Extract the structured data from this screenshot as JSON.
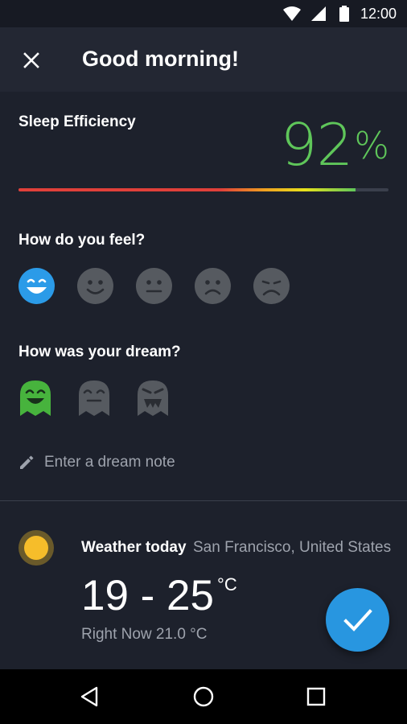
{
  "status_bar": {
    "time": "12:00",
    "icons": [
      "wifi-icon",
      "signal-icon",
      "battery-icon"
    ]
  },
  "app_bar": {
    "title": "Good morning!",
    "close_icon": "close-icon"
  },
  "sleep_efficiency": {
    "label": "Sleep Efficiency",
    "value": "92",
    "unit": "%",
    "fraction": 0.91,
    "value_color": "#5fc65a"
  },
  "feel": {
    "question": "How do you feel?",
    "options": [
      "very-happy-face-icon",
      "happy-face-icon",
      "neutral-face-icon",
      "sad-face-icon",
      "very-sad-face-icon"
    ],
    "selected_index": 0
  },
  "dream": {
    "question": "How was your dream?",
    "options": [
      "happy-ghost-icon",
      "neutral-ghost-icon",
      "angry-ghost-icon"
    ],
    "selected_index": 0,
    "selected_color": "#47b33d"
  },
  "note": {
    "placeholder": "Enter a dream note",
    "icon": "pencil-icon"
  },
  "weather": {
    "title": "Weather today",
    "location": "San Francisco, United States",
    "range": "19 - 25",
    "unit": "°C",
    "now": "Right Now 21.0 °C",
    "icon": "sun-icon"
  },
  "fab": {
    "icon": "check-icon",
    "color": "#2896e0"
  },
  "nav_bar": {
    "icons": [
      "back-icon",
      "home-icon",
      "recents-icon"
    ]
  }
}
